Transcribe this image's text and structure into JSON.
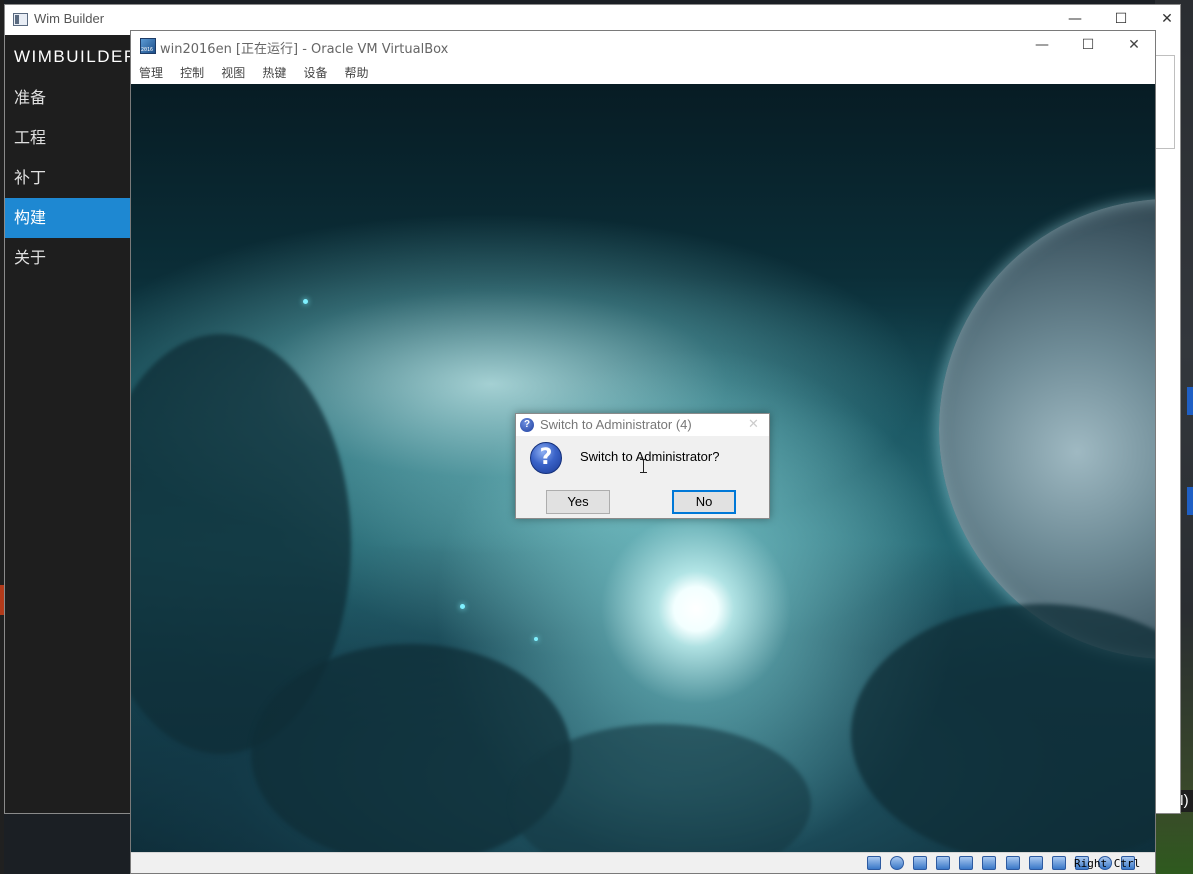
{
  "desktop": {
    "taskbar_fragment": "-CN)"
  },
  "wim_builder": {
    "window_title": "Wim Builder",
    "brand": "WIMBUILDER",
    "controls": {
      "minimize": "—",
      "maximize": "☐",
      "close": "✕"
    },
    "nav": [
      {
        "label": "准备"
      },
      {
        "label": "工程"
      },
      {
        "label": "补丁"
      },
      {
        "label": "构建",
        "active": true
      },
      {
        "label": "关于"
      }
    ],
    "accent_color": "#1e88d2"
  },
  "virtualbox": {
    "window_title": "win2016en [正在运行] - Oracle VM VirtualBox",
    "controls": {
      "minimize": "—",
      "maximize": "☐",
      "close": "✕"
    },
    "menu": [
      "管理",
      "控制",
      "视图",
      "热键",
      "设备",
      "帮助"
    ],
    "status_icons": [
      "hard-disk-icon",
      "optical-drive-icon",
      "audio-icon",
      "network-icon",
      "usb-icon",
      "shared-folders-icon",
      "display-icon",
      "video-capture-icon",
      "cpu-icon",
      "guest-additions-icon",
      "mouse-integration-icon",
      "keyboard-capture-icon"
    ],
    "host_key": "Right Ctrl"
  },
  "dialog": {
    "title": "Switch to Administrator (4)",
    "close": "✕",
    "icon": "?",
    "message": "Switch to Administrator?",
    "yes_label": "Yes",
    "no_label": "No"
  }
}
